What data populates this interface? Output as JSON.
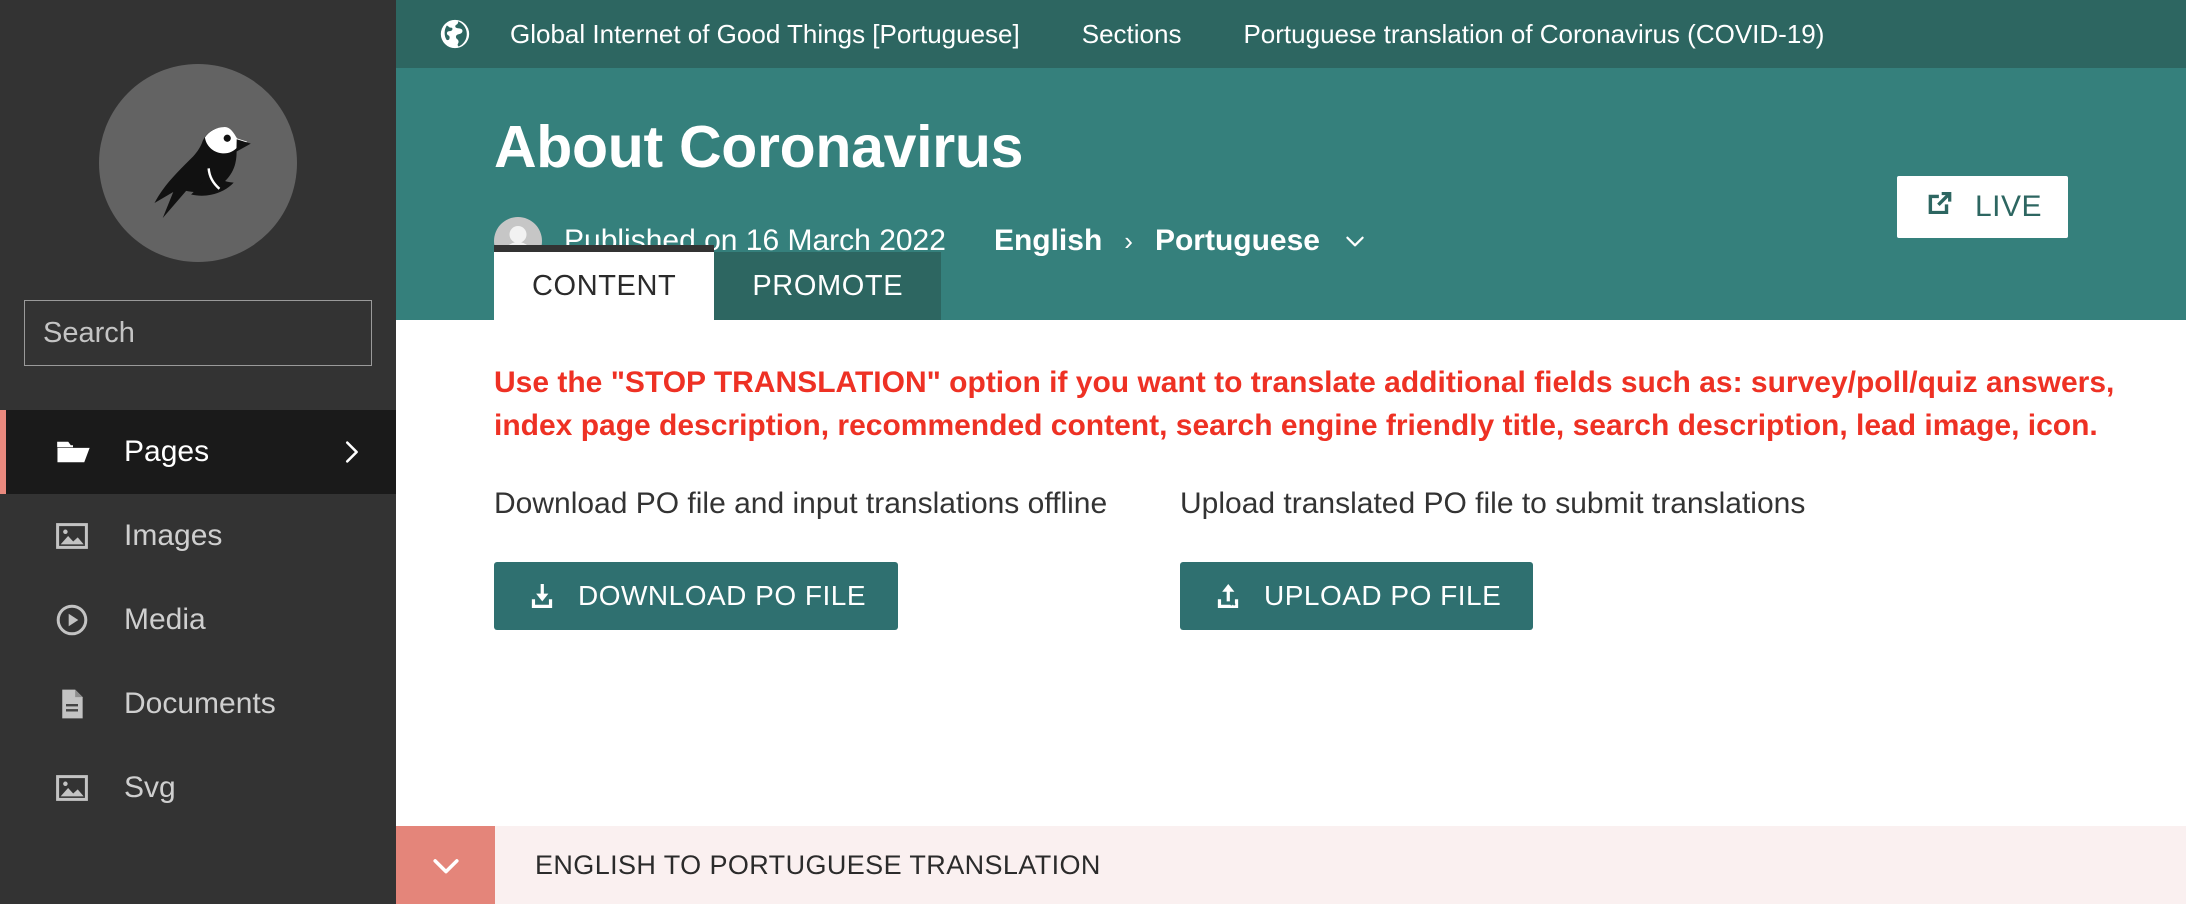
{
  "sidebar": {
    "logo_name": "wagtail-bird-logo",
    "search": {
      "placeholder": "Search",
      "value": "",
      "icon": "search-icon"
    },
    "items": [
      {
        "label": "Pages",
        "icon": "folder-open-icon",
        "active": true,
        "chevron": "chevron-right-icon"
      },
      {
        "label": "Images",
        "icon": "image-icon",
        "active": false,
        "chevron": ""
      },
      {
        "label": "Media",
        "icon": "play-circle-icon",
        "active": false,
        "chevron": ""
      },
      {
        "label": "Documents",
        "icon": "document-icon",
        "active": false,
        "chevron": ""
      },
      {
        "label": "Svg",
        "icon": "image-icon",
        "active": false,
        "chevron": ""
      }
    ]
  },
  "breadcrumb": {
    "site_icon": "globe-icon",
    "items": [
      "Global Internet of Good Things [Portuguese]",
      "Sections",
      "Portuguese translation of Coronavirus (COVID-19)"
    ]
  },
  "hero": {
    "title": "About Coronavirus",
    "live_button": {
      "label": "LIVE",
      "icon": "external-link-icon"
    },
    "published": "Published on 16 March 2022",
    "avatar": "avatar",
    "language_from": "English",
    "language_separator": "›",
    "language_to": "Portuguese",
    "language_caret": "chevron-down-icon"
  },
  "tabs": [
    {
      "label": "CONTENT",
      "active": true
    },
    {
      "label": "PROMOTE",
      "active": false
    }
  ],
  "main": {
    "warning": "Use the \"STOP TRANSLATION\" option if you want to translate additional fields such as: survey/poll/quiz answers, index page description, recommended content, search engine friendly title, search description, lead image, icon.",
    "download": {
      "label": "Download PO file and input translations offline",
      "button_label": "DOWNLOAD PO FILE",
      "button_icon": "download-icon"
    },
    "upload": {
      "label": "Upload translated PO file to submit translations",
      "button_label": "UPLOAD PO FILE",
      "button_icon": "upload-icon"
    }
  },
  "accordion": {
    "title": "ENGLISH TO PORTUGUESE TRANSLATION",
    "toggle_icon": "chevron-down-icon"
  },
  "colors": {
    "sidebar_bg": "#333333",
    "sidebar_active_bg": "#1a1a1a",
    "sidebar_active_border": "#e9897e",
    "hero_teal": "#35807c",
    "dark_teal": "#2d6661",
    "button_teal": "#2f7070",
    "warning_red": "#ee3124",
    "accordion_salmon": "#e4857a",
    "accordion_bg": "#faf0f0"
  }
}
